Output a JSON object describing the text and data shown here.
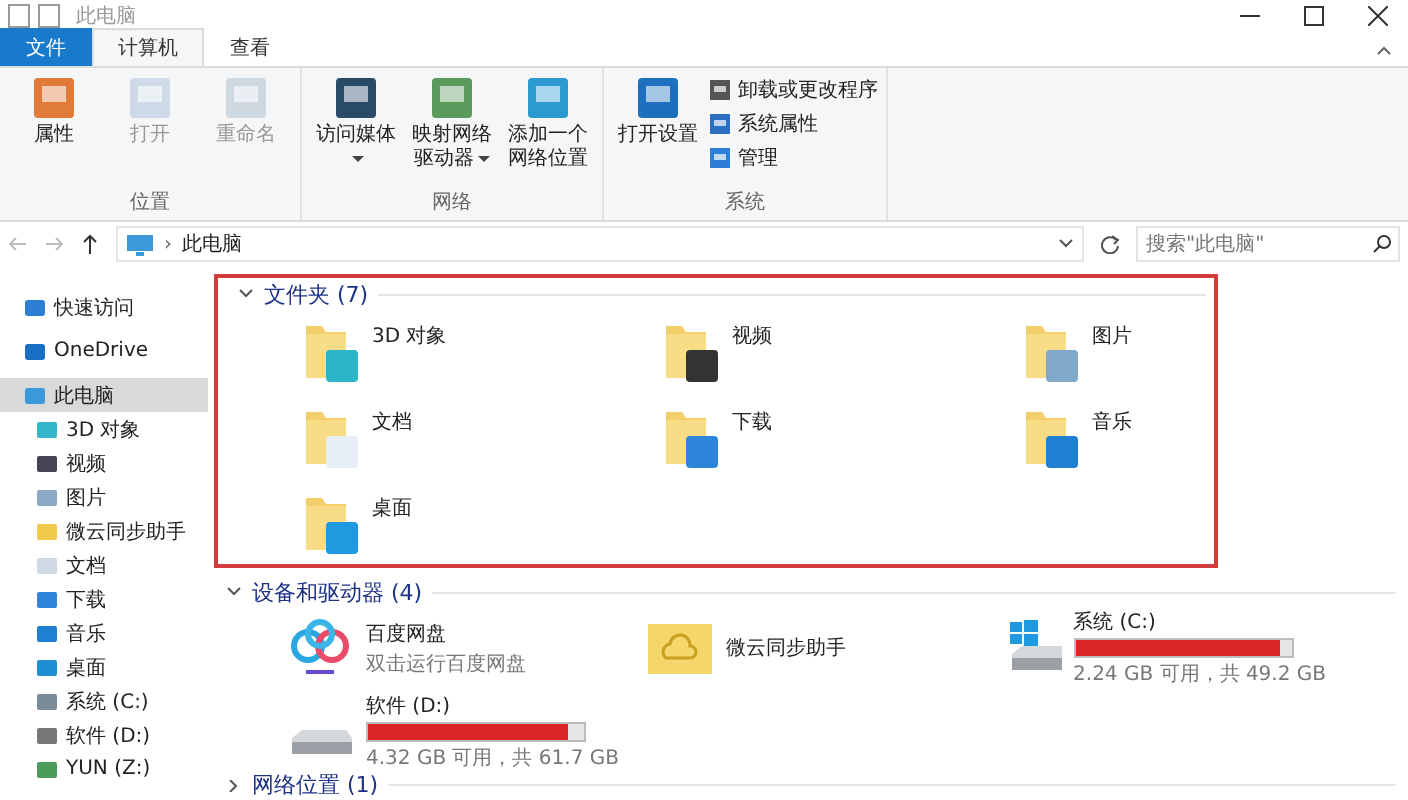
{
  "window": {
    "title": "此电脑"
  },
  "tabs": [
    {
      "label": "文件",
      "kind": "file",
      "selected": false
    },
    {
      "label": "计算机",
      "kind": "tab",
      "selected": true
    },
    {
      "label": "查看",
      "kind": "tab",
      "selected": false
    }
  ],
  "ribbon": [
    {
      "label": "位置",
      "buttons": [
        {
          "label": "属性",
          "kind": "properties",
          "disabled": false,
          "dropdown": false
        },
        {
          "label": "打开",
          "kind": "open",
          "disabled": true,
          "dropdown": false
        },
        {
          "label": "重命名",
          "kind": "rename",
          "disabled": true,
          "dropdown": false
        }
      ]
    },
    {
      "label": "网络",
      "buttons": [
        {
          "label": "访问媒体",
          "kind": "media",
          "disabled": false,
          "dropdown": true
        },
        {
          "label": "映射网络驱动器",
          "kind": "map",
          "disabled": false,
          "dropdown": true
        },
        {
          "label": "添加一个网络位置",
          "kind": "netloc",
          "disabled": false,
          "dropdown": false
        }
      ]
    },
    {
      "label": "系统",
      "buttons": [
        {
          "label": "打开设置",
          "kind": "settings",
          "disabled": false,
          "dropdown": false
        }
      ],
      "small": [
        {
          "label": "卸载或更改程序",
          "kind": "uninstall"
        },
        {
          "label": "系统属性",
          "kind": "sysprops"
        },
        {
          "label": "管理",
          "kind": "manage"
        }
      ]
    }
  ],
  "address": {
    "separator": "›",
    "path": "此电脑",
    "search_placeholder": "搜索\"此电脑\""
  },
  "sidebar": [
    {
      "label": "快速访问",
      "kind": "star",
      "selected": false
    },
    {
      "label": "OneDrive",
      "kind": "cloud",
      "selected": false
    },
    {
      "label": "此电脑",
      "kind": "pc",
      "selected": true,
      "children": [
        {
          "label": "3D 对象",
          "kind": "cube"
        },
        {
          "label": "视频",
          "kind": "video"
        },
        {
          "label": "图片",
          "kind": "picture"
        },
        {
          "label": "微云同步助手",
          "kind": "weiyun"
        },
        {
          "label": "文档",
          "kind": "doc"
        },
        {
          "label": "下载",
          "kind": "download"
        },
        {
          "label": "音乐",
          "kind": "music"
        },
        {
          "label": "桌面",
          "kind": "desktop"
        },
        {
          "label": "系统 (C:)",
          "kind": "sysdrive"
        },
        {
          "label": "软件 (D:)",
          "kind": "drive"
        },
        {
          "label": "YUN (Z:)",
          "kind": "netdrive"
        }
      ]
    }
  ],
  "folders": {
    "title": "文件夹 (7)",
    "expanded": true,
    "items": [
      {
        "label": "3D 对象",
        "kind": "cube"
      },
      {
        "label": "视频",
        "kind": "video"
      },
      {
        "label": "图片",
        "kind": "picture"
      },
      {
        "label": "文档",
        "kind": "doc"
      },
      {
        "label": "下载",
        "kind": "download"
      },
      {
        "label": "音乐",
        "kind": "music"
      },
      {
        "label": "桌面",
        "kind": "desktop"
      }
    ]
  },
  "devices": {
    "title": "设备和驱动器 (4)",
    "expanded": true,
    "items": [
      {
        "label": "百度网盘",
        "kind": "app",
        "detail": "双击运行百度网盘"
      },
      {
        "label": "微云同步助手",
        "kind": "weiyun"
      },
      {
        "label": "系统 (C:)",
        "kind": "sysdrive",
        "level": 0.95,
        "detail": "2.24 GB 可用，共 49.2 GB"
      },
      {
        "label": "软件 (D:)",
        "kind": "drive",
        "level": 0.93,
        "detail": "4.32 GB 可用，共 61.7 GB"
      }
    ]
  },
  "network": {
    "title": "网络位置 (1)",
    "expanded": false
  }
}
